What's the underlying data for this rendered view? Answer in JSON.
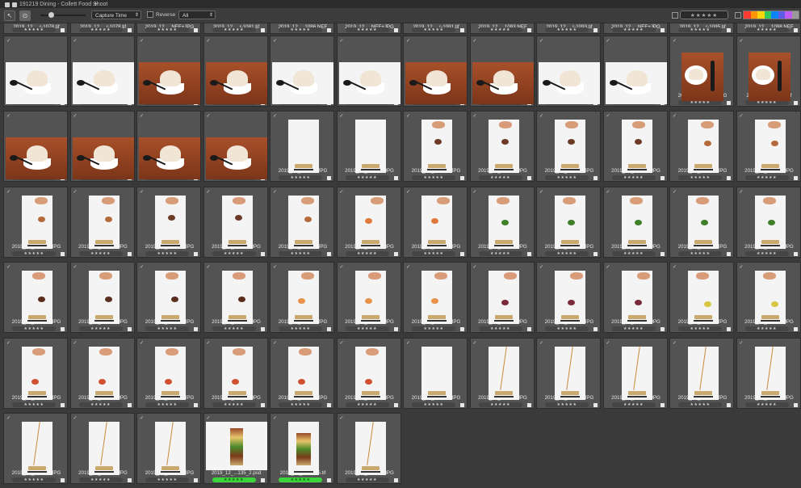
{
  "window": {
    "title": "191219 Dining - Collett Food Shoot",
    "new_tab": "+"
  },
  "toolbar": {
    "sort": "Capture Time",
    "reverse_label": "Reverse",
    "filter": "All",
    "star_filter": "★★★★★"
  },
  "colors": {
    "accent_green": "#3bd43b",
    "wood": "#9a4522"
  },
  "label_swatches": [
    "#ff3b30",
    "#ff9500",
    "#ffd60a",
    "#34c759",
    "#0a84ff",
    "#5e5ce6",
    "#bf5af2",
    "#9a9a9a"
  ],
  "top_row_names": [
    "2019_12_...r-1078.tif",
    "2019_12_...r-1078.tif",
    "2019_12_...NEF+JPG",
    "2019_12_...r-1081.tif",
    "2019_12_...1086.NEF",
    "2019_12_...NEF+JPG",
    "2019_12_...r-1091.tif",
    "2019_12_...1093.NEF",
    "2019_12_...r-1093.tif",
    "2019_12_...NEF+JPG",
    "2019_12_...r-1095.tif",
    "2019_12_...1098.NEF"
  ],
  "rows": [
    {
      "names": [
        "2019_12_...r-1098.tif",
        "2019_12_...1100.NEF",
        "2019_12_...NEF+JPG",
        "2019_12_...r-1104.tif",
        "2019_12_...1106.NEF",
        "2019_12_...r-1106.tif",
        "2019_12_...NEF+JPG",
        "2019_12_...r-1109.tif",
        "2019_12_...1111.NEF",
        "2019_12_...r-1111.tif",
        "2019_12_...NEF+JPG",
        "2019_12_...r-1115.tif"
      ]
    },
    {
      "names": [
        "2019_12_...NEF+JPG",
        "2019_12_...r-1118.tif",
        "2019_12_...NEF+JPG",
        "2019_12_...r-1122.tif",
        "2019_12_...NEF+JPG",
        "2019_12_...NEF+JPG",
        "2019_12_...NEF+JPG",
        "2019_12_...NEF+JPG",
        "2019_12_...NEF+JPG",
        "2019_12_...NEF+JPG",
        "2019_12_...NEF+JPG",
        "2019_12_...NEF+JPG"
      ]
    },
    {
      "names": [
        "2019_12_...NEF+JPG",
        "2019_12_...NEF+JPG",
        "2019_12_...NEF+JPG",
        "2019_12_...NEF+JPG",
        "2019_12_...NEF+JPG",
        "2019_12_...NEF+JPG",
        "2019_12_...NEF+JPG",
        "2019_12_...NEF+JPG",
        "2019_12_...NEF+JPG",
        "2019_12_...NEF+JPG",
        "2019_12_...NEF+JPG",
        "2019_12_...NEF+JPG"
      ]
    },
    {
      "names": [
        "2019_12_...NEF+JPG",
        "2019_12_...NEF+JPG",
        "2019_12_...NEF+JPG",
        "2019_12_...NEF+JPG",
        "2019_12_...NEF+JPG",
        "2019_12_...NEF+JPG",
        "2019_12_...NEF+JPG",
        "2019_12_...NEF+JPG",
        "2019_12_...NEF+JPG",
        "2019_12_...NEF+JPG",
        "2019_12_...NEF+JPG",
        "2019_12_...NEF+JPG"
      ]
    },
    {
      "names": [
        "2019_12_...NEF+JPG",
        "2019_12_...NEF+JPG",
        "2019_12_...NEF+JPG",
        "2019_12_...NEF+JPG",
        "2019_12_...NEF+JPG",
        "2019_12_...NEF+JPG",
        "2019_12_...NEF+JPG",
        "2019_12_...NEF+JPG",
        "2019_12_...NEF+JPG",
        "2019_12_...NEF+JPG",
        "2019_12_...NEF+JPG",
        "2019_12_...NEF+JPG"
      ]
    },
    {
      "names": [
        "2019_12_...NEF+JPG",
        "2019_12_...NEF+JPG",
        "2019_12_...NEF+JPG",
        "2019_12_...135_2.psd",
        "2019_12_...r-1135.tif",
        "2019_12_...NEF+JPG"
      ]
    }
  ],
  "rating_default": "★★★★★",
  "green_rated": [
    3,
    4
  ]
}
